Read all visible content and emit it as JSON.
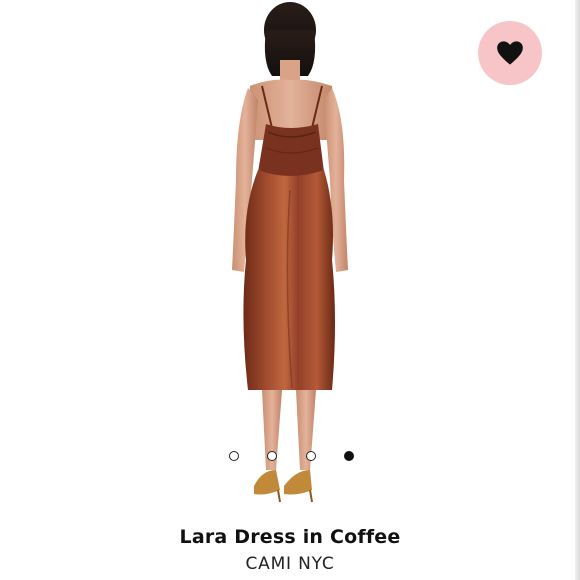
{
  "product": {
    "title": "Lara Dress in Coffee",
    "brand": "CAMI NYC",
    "image_subject": "back-view-slip-dress"
  },
  "favorite": {
    "icon": "heart-icon",
    "background_color": "#f7c5c8",
    "icon_color": "#111111",
    "is_favorited": true
  },
  "gallery": {
    "dot_count": 4,
    "active_index": 3,
    "dress_color": "#8a3a24"
  }
}
